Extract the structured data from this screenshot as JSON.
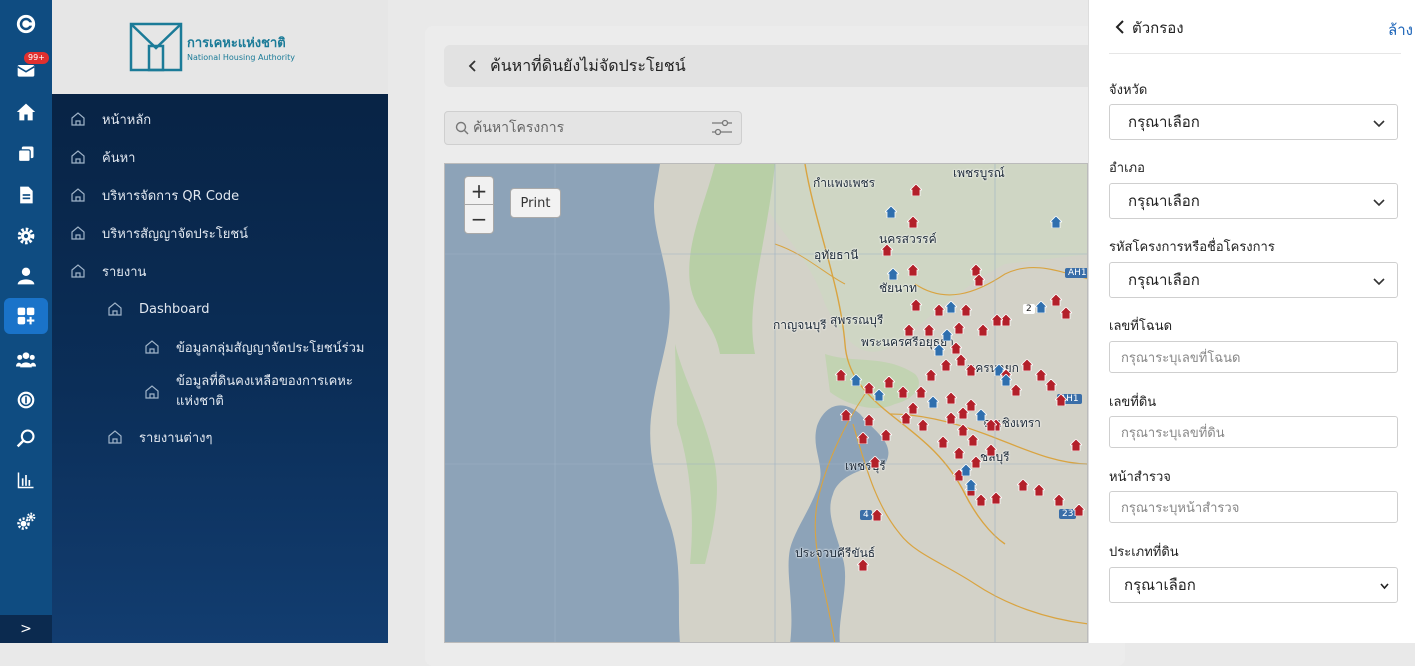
{
  "rail": {
    "badge": "99+"
  },
  "brand": {
    "name_th": "การเคหะแห่งชาติ",
    "name_en": "National Housing Authority"
  },
  "nav": {
    "home": "หน้าหลัก",
    "search": "ค้นหา",
    "qr": "บริหารจัดการ QR Code",
    "contract": "บริหารสัญญาจัดประโยชน์",
    "report": "รายงาน",
    "dashboard": "Dashboard",
    "dash_item1": "ข้อมูลกลุ่มสัญญาจัดประโยชน์ร่วม",
    "dash_item2": "ข้อมูลที่ดินคงเหลือของการเคหะแห่งชาติ",
    "reports_misc": "รายงานต่างๆ"
  },
  "page": {
    "title": "ค้นหาที่ดินยังไม่จัดประโยชน์"
  },
  "search": {
    "placeholder": "ค้นหาโครงการ"
  },
  "map": {
    "zoom_in": "+",
    "zoom_out": "−",
    "print": "Print",
    "places": {
      "p1": "กำแพงเพชร",
      "p2": "เพชรบูรณ์",
      "p3": "นครสวรรค์",
      "p4": "อุทัยธานี",
      "p5": "ชัยนาท",
      "p6": "สุพรรณบุรี",
      "p7": "กาญจนบุรี",
      "p8": "พระนครศรีอยุธยา",
      "p9": "นครนายก",
      "p10": "ฉะเชิงเทรา",
      "p11": "ชลบุรี",
      "p12": "เพชรบุรี",
      "p13": "ประจวบคีรีขันธ์"
    },
    "roads": {
      "ah1": "AH1",
      "ah1b": "AH1",
      "r2": "2",
      "r4": "4",
      "r23": "23"
    }
  },
  "filter": {
    "title": "ตัวกรอง",
    "clear": "ล้าง",
    "province_label": "จังหวัด",
    "province_value": "กรุณาเลือก",
    "district_label": "อำเภอ",
    "district_value": "กรุณาเลือก",
    "project_label": "รหัสโครงการหรือชื่อโครงการ",
    "project_value": "กรุณาเลือก",
    "deed_label": "เลขที่โฉนด",
    "deed_placeholder": "กรุณาระบุเลขที่โฉนด",
    "land_label": "เลขที่ดิน",
    "land_placeholder": "กรุณาระบุเลขที่ดิน",
    "survey_label": "หน้าสำรวจ",
    "survey_placeholder": "กรุณาระบุหน้าสำรวจ",
    "type_label": "ประเภทที่ดิน",
    "type_value": "กรุณาเลือก"
  },
  "colors": {
    "rail": "#0f4c81",
    "active": "#1a73c9",
    "pin_red": "#b3202a",
    "pin_blue": "#2f6fae",
    "link": "#1a63b8"
  }
}
